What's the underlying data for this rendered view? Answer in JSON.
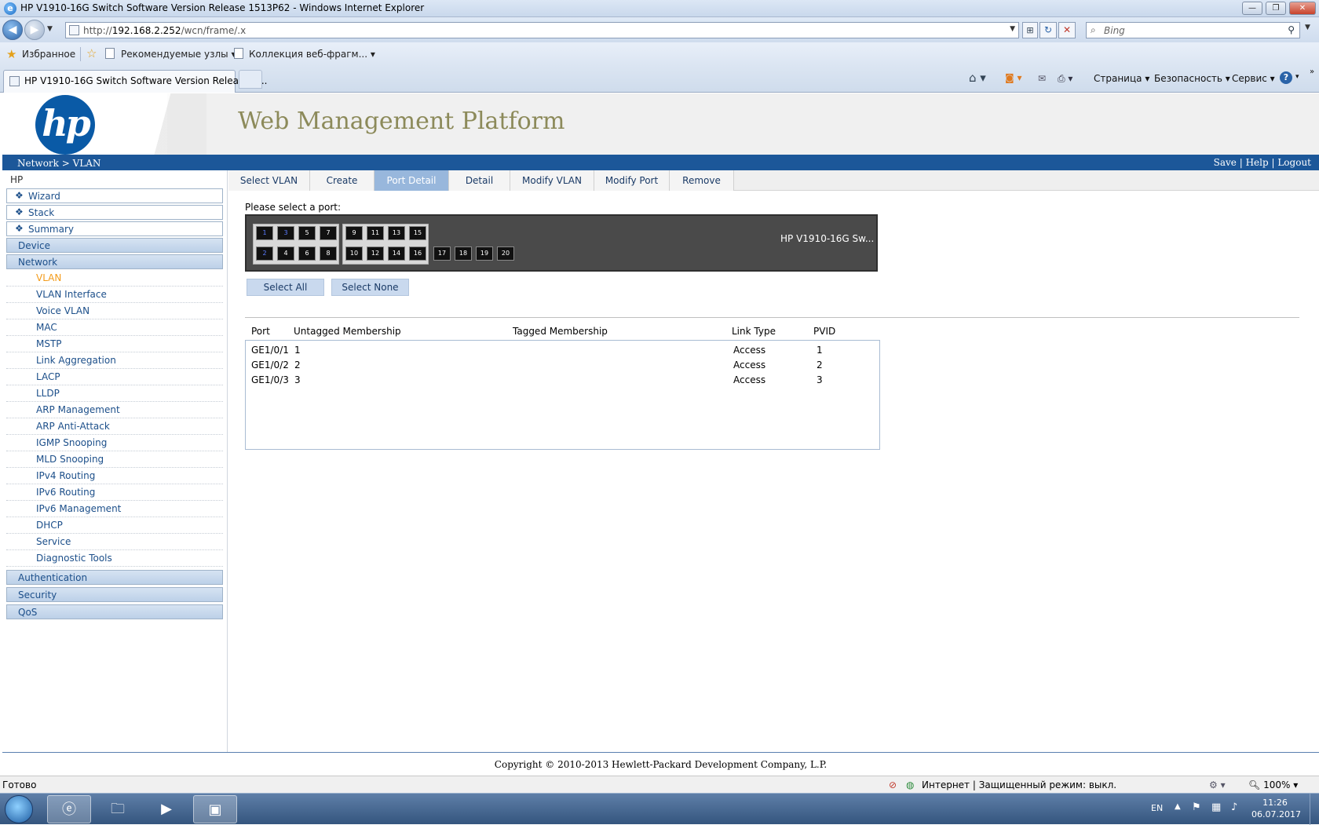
{
  "window": {
    "title": "HP V1910-16G Switch Software Version Release 1513P62 - Windows Internet Explorer",
    "min": "—",
    "max": "❐",
    "close": "✕"
  },
  "browser": {
    "url_prefix": "http://",
    "url_host": "192.168.2.252",
    "url_path": "/wcn/frame/.x",
    "search_placeholder": "Bing",
    "favorites_label": "Избранное",
    "fav_links": [
      "Рекомендуемые узлы",
      "Коллекция веб-фрагм..."
    ],
    "tab_title": "HP V1910-16G Switch Software Version Release 1...",
    "commands": [
      "Страница",
      "Безопасность",
      "Сервис"
    ]
  },
  "header": {
    "logo": "hp",
    "title": "Web Management Platform",
    "breadcrumb": "Network > VLAN",
    "links": "Save | Help | Logout"
  },
  "sidebar": {
    "root": "HP",
    "top_items": [
      "Wizard",
      "Stack",
      "Summary"
    ],
    "categories_before": [
      "Device",
      "Network"
    ],
    "network_items": [
      "VLAN",
      "VLAN Interface",
      "Voice VLAN",
      "MAC",
      "MSTP",
      "Link Aggregation",
      "LACP",
      "LLDP",
      "ARP Management",
      "ARP Anti-Attack",
      "IGMP Snooping",
      "MLD Snooping",
      "IPv4 Routing",
      "IPv6 Routing",
      "IPv6 Management",
      "DHCP",
      "Service",
      "Diagnostic Tools"
    ],
    "active_item": "VLAN",
    "categories_after": [
      "Authentication",
      "Security",
      "QoS"
    ]
  },
  "tabs": [
    "Select VLAN",
    "Create",
    "Port Detail",
    "Detail",
    "Modify VLAN",
    "Modify Port",
    "Remove"
  ],
  "active_tab": "Port Detail",
  "port_select": {
    "prompt": "Please select a port:",
    "model": "HP V1910-16G Sw...",
    "ports_top": [
      "1",
      "3",
      "5",
      "7",
      "9",
      "11",
      "13",
      "15"
    ],
    "ports_bottom": [
      "2",
      "4",
      "6",
      "8",
      "10",
      "12",
      "14",
      "16"
    ],
    "ports_sfp": [
      "17",
      "18",
      "19",
      "20"
    ],
    "selected_ports": [
      "1",
      "2",
      "3"
    ],
    "select_all": "Select All",
    "select_none": "Select None"
  },
  "table": {
    "headers": [
      "Port",
      "Untagged Membership",
      "Tagged Membership",
      "Link Type",
      "PVID"
    ],
    "rows": [
      [
        "GE1/0/1",
        "1",
        "",
        "Access",
        "1"
      ],
      [
        "GE1/0/2",
        "2",
        "",
        "Access",
        "2"
      ],
      [
        "GE1/0/3",
        "3",
        "",
        "Access",
        "3"
      ]
    ]
  },
  "footer": "Copyright © 2010-2013 Hewlett-Packard Development Company, L.P.",
  "status": {
    "left": "Готово",
    "zone": "Интернет | Защищенный режим: выкл.",
    "zoom": "100%"
  },
  "taskbar": {
    "lang": "EN",
    "time": "11:26",
    "date": "06.07.2017"
  }
}
